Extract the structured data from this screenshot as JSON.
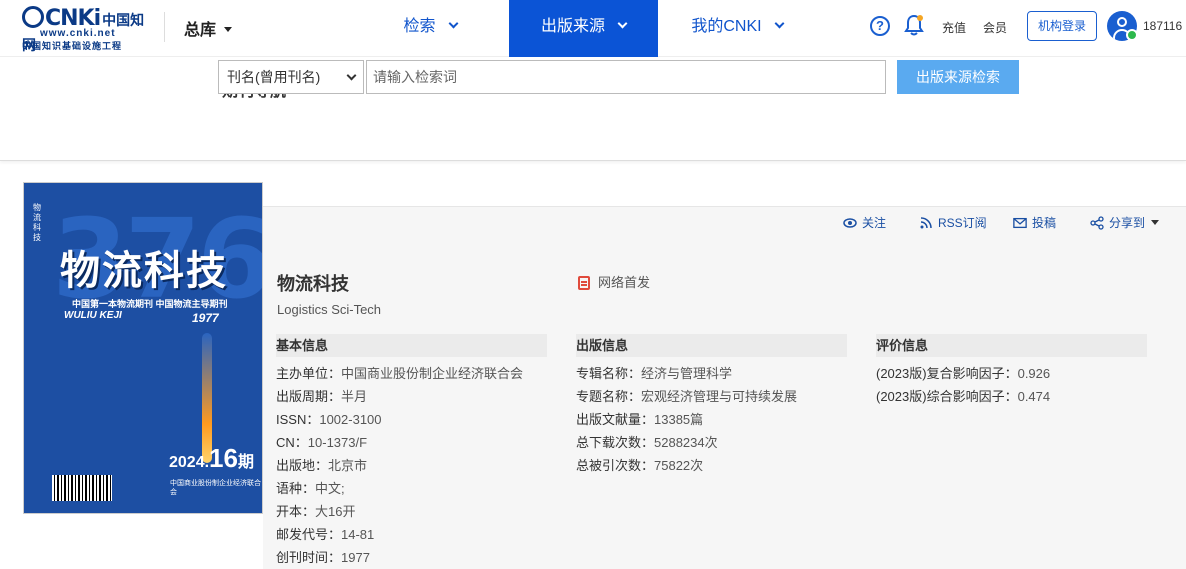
{
  "header": {
    "logo_brand": "CNKi",
    "logo_brand_cn": "中国知网",
    "logo_url": "www.cnki.net",
    "logo_sub": "中国知识基础设施工程",
    "library": "总库",
    "nav": {
      "search": "检索",
      "publication_source": "出版来源",
      "my_cnki": "我的CNKI"
    },
    "help": "?",
    "recharge": "充值",
    "member": "会员",
    "institution_login": "机构登录",
    "username": "187116"
  },
  "subbar": {
    "journal_nav": "期刊导航",
    "select_value": "刊名(曾用刊名)",
    "search_placeholder": "请输入检索词",
    "search_button": "出版来源检索"
  },
  "cover": {
    "big_number": "376",
    "title": "物流科技",
    "tagline": "中国第一本物流期刊  中国物流主导期刊",
    "pinyin": "WULIU KEJI",
    "founded": "1977",
    "issue_year": "2024.",
    "issue_no": "16",
    "issue_suffix": "期"
  },
  "actions": {
    "follow": "关注",
    "rss": "RSS订阅",
    "submit": "投稿",
    "share": "分享到"
  },
  "journal": {
    "title_cn": "物流科技",
    "title_en": "Logistics Sci-Tech",
    "first_online": "网络首发"
  },
  "basic_info": {
    "heading": "基本信息",
    "items": [
      {
        "label": "主办单位：",
        "value": "中国商业股份制企业经济联合会"
      },
      {
        "label": "出版周期：",
        "value": "半月"
      },
      {
        "label": "ISSN：",
        "value": "1002-3100"
      },
      {
        "label": "CN：",
        "value": "10-1373/F"
      },
      {
        "label": "出版地：",
        "value": "北京市"
      },
      {
        "label": "语种：",
        "value": "中文;"
      },
      {
        "label": "开本：",
        "value": "大16开"
      },
      {
        "label": "邮发代号：",
        "value": "14-81"
      },
      {
        "label": "创刊时间：",
        "value": "1977"
      }
    ]
  },
  "publication_info": {
    "heading": "出版信息",
    "items": [
      {
        "label": "专辑名称：",
        "value": "经济与管理科学"
      },
      {
        "label": "专题名称：",
        "value": "宏观经济管理与可持续发展"
      },
      {
        "label": "出版文献量：",
        "value": "13385篇"
      },
      {
        "label": "总下载次数：",
        "value": "5288234次"
      },
      {
        "label": "总被引次数：",
        "value": "75822次"
      }
    ]
  },
  "evaluation_info": {
    "heading": "评价信息",
    "items": [
      {
        "label": "(2023版)复合影响因子：",
        "value": "0.926"
      },
      {
        "label": "(2023版)综合影响因子：",
        "value": "0.474"
      }
    ]
  },
  "colors": {
    "primary": "#0b54d6",
    "link": "#1155cc",
    "search_button": "#5aaaf0",
    "accent_red": "#e85c4a"
  }
}
